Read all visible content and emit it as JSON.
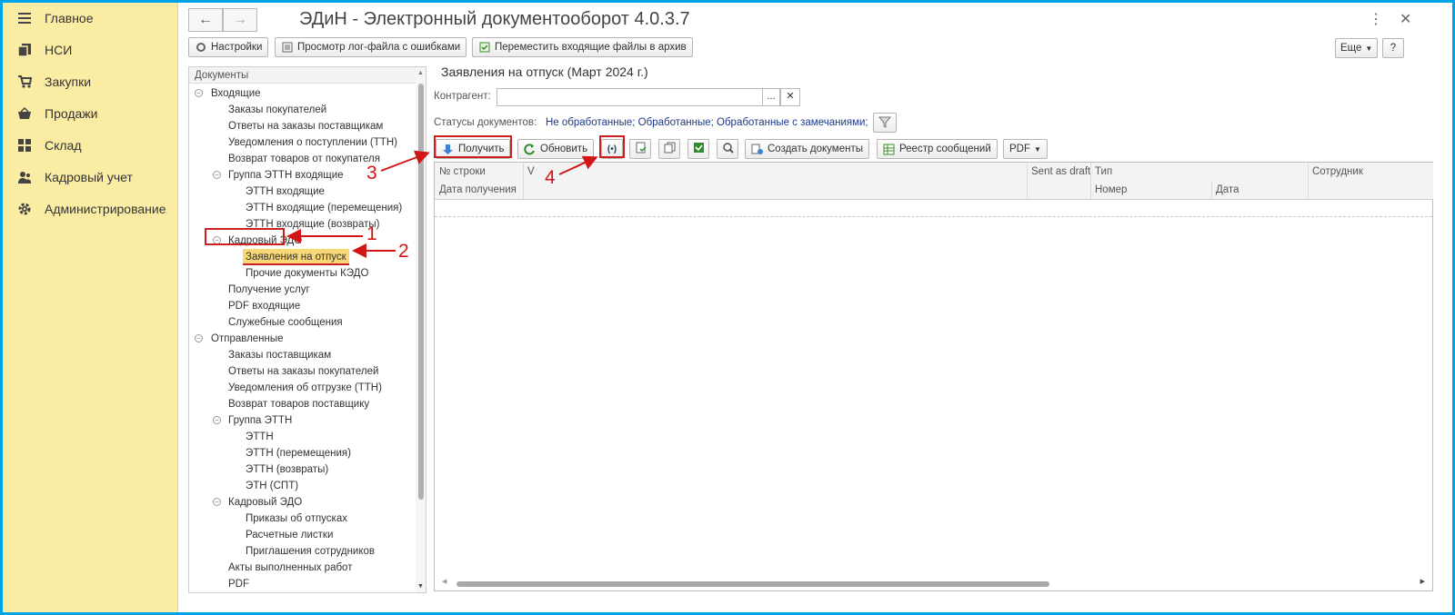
{
  "sections": [
    {
      "label": "Главное",
      "icon": "menu-icon"
    },
    {
      "label": "НСИ",
      "icon": "copy-icon"
    },
    {
      "label": "Закупки",
      "icon": "cart-icon"
    },
    {
      "label": "Продажи",
      "icon": "basket-icon"
    },
    {
      "label": "Склад",
      "icon": "warehouse-icon"
    },
    {
      "label": "Кадровый учет",
      "icon": "users-icon"
    },
    {
      "label": "Администрирование",
      "icon": "gear-icon"
    }
  ],
  "window": {
    "title": "ЭДиН - Электронный документооборот 4.0.3.7"
  },
  "toolbar": {
    "settings": "Настройки",
    "log": "Просмотр лог-файла с ошибками",
    "archive": "Переместить входящие файлы в архив",
    "more": "Еще",
    "help": "?"
  },
  "tree": {
    "header": "Документы",
    "nodes": [
      "Входящие",
      "Заказы покупателей",
      "Ответы на заказы поставщикам",
      "Уведомления о поступлении (ТТН)",
      "Возврат товаров от покупателя",
      "Группа ЭТТН входящие",
      "ЭТТН входящие",
      "ЭТТН входящие (перемещения)",
      "ЭТТН входящие (возвраты)",
      "Кадровый ЭДО",
      "Заявления на отпуск",
      "Прочие документы КЭДО",
      "Получение услуг",
      "PDF входящие",
      "Служебные сообщения",
      "Отправленные",
      "Заказы поставщикам",
      "Ответы на заказы покупателей",
      "Уведомления об отгрузке (ТТН)",
      "Возврат товаров поставщику",
      "Группа ЭТТН",
      "ЭТТН",
      "ЭТТН (перемещения)",
      "ЭТТН (возвраты)",
      "ЭТН (СПТ)",
      "Кадровый ЭДО",
      "Приказы об отпусках",
      "Расчетные листки",
      "Приглашения сотрудников",
      "Акты выполненных работ",
      "PDF"
    ]
  },
  "content": {
    "title": "Заявления на отпуск (Март 2024 г.)",
    "counterparty_label": "Контрагент:",
    "counterparty_value": "",
    "statuses_label": "Статусы документов:",
    "statuses_value": "Не обработанные; Обработанные; Обработанные с замечаниями;",
    "buttons": {
      "receive": "Получить",
      "refresh": "Обновить",
      "create": "Создать документы",
      "registry": "Реестр сообщений",
      "pdf": "PDF"
    },
    "columns": {
      "row": "№ строки",
      "v": "V",
      "sent_draft": "Sent as draft",
      "type": "Тип",
      "employee": "Сотрудник",
      "received": "Дата получения",
      "number": "Номер",
      "date": "Дата"
    }
  },
  "annotations": [
    "1",
    "2",
    "3",
    "4"
  ],
  "colors": {
    "frame": "#00a3e8",
    "sections_bg": "#fbeca4",
    "annotation": "#cc1f1f",
    "selected": "#f7d776"
  }
}
